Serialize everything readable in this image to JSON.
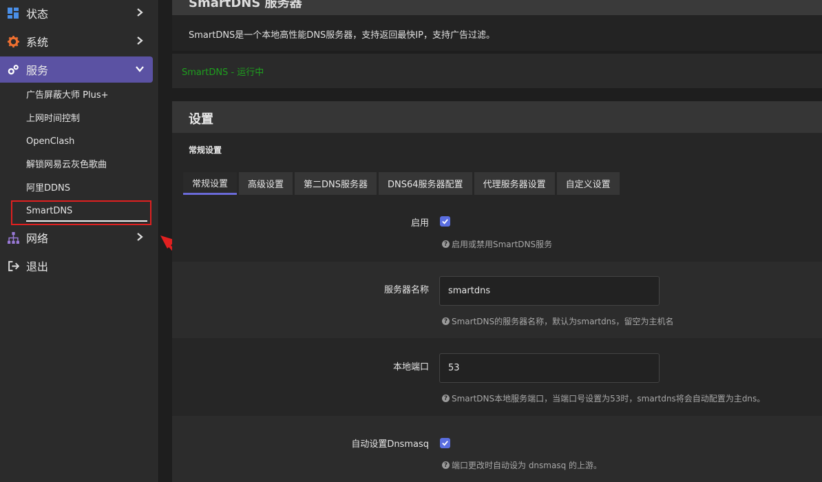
{
  "sidebar": {
    "items": [
      {
        "label": "状态",
        "icon": "dashboard-icon"
      },
      {
        "label": "系统",
        "icon": "gear-icon"
      },
      {
        "label": "服务",
        "icon": "cogs-icon"
      },
      {
        "label": "网络",
        "icon": "network-icon"
      },
      {
        "label": "退出",
        "icon": "logout-icon"
      }
    ],
    "service_subitems": [
      "广告屏蔽大师 Plus+",
      "上网时间控制",
      "OpenClash",
      "解锁网易云灰色歌曲",
      "阿里DDNS",
      "SmartDNS"
    ]
  },
  "main": {
    "top_title": "SmartDNS 服务器",
    "description": "SmartDNS是一个本地高性能DNS服务器，支持返回最快IP，支持广告过滤。",
    "status": "SmartDNS - 运行中",
    "settings_title": "设置",
    "subsection_title": "常规设置",
    "tabs": [
      "常规设置",
      "高级设置",
      "第二DNS服务器",
      "DNS64服务器配置",
      "代理服务器设置",
      "自定义设置"
    ],
    "fields": {
      "enable": {
        "label": "启用",
        "checked": true,
        "help": "启用或禁用SmartDNS服务"
      },
      "server_name": {
        "label": "服务器名称",
        "value": "smartdns",
        "help": "SmartDNS的服务器名称，默认为smartdns，留空为主机名"
      },
      "local_port": {
        "label": "本地端口",
        "value": "53",
        "help": "SmartDNS本地服务端口，当端口号设置为53时，smartdns将会自动配置为主dns。"
      },
      "auto_dnsmasq": {
        "label": "自动设置Dnsmasq",
        "checked": true,
        "help": "端口更改时自动设为 dnsmasq 的上游。"
      }
    }
  },
  "colors": {
    "accent": "#5b52a3",
    "status_green": "#1ea01e",
    "highlight_red": "#e02020"
  }
}
